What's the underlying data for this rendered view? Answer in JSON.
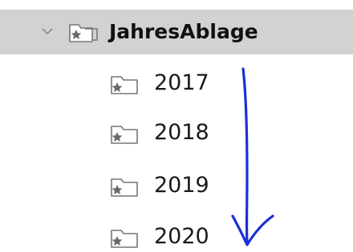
{
  "tree": {
    "root": {
      "label": "JahresAblage",
      "expanded": true,
      "icon": "starred-folder-icon"
    },
    "children": [
      {
        "label": "2017",
        "icon": "starred-folder-icon"
      },
      {
        "label": "2018",
        "icon": "starred-folder-icon"
      },
      {
        "label": "2019",
        "icon": "starred-folder-icon"
      },
      {
        "label": "2020",
        "icon": "starred-folder-icon"
      }
    ]
  },
  "colors": {
    "selected_row": "#d2d2d2",
    "annotation_ink": "#1a2fd6",
    "folder_outline": "#6f6f6f"
  }
}
